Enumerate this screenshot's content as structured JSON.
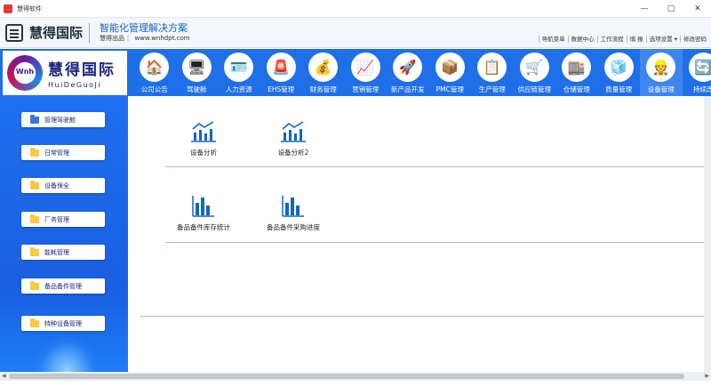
{
  "window": {
    "title": "慧得软件",
    "controls": [
      "—",
      "▢",
      "✕"
    ]
  },
  "header": {
    "brand": "慧得国际",
    "slogan": "智能化管理解决方案",
    "site": "慧得出品 ： www.wnhdpt.com",
    "links": [
      "导航菜单",
      "数据中心",
      "工作流程",
      "填 报",
      "选项设置 ▾",
      "修改密码"
    ]
  },
  "logo": {
    "mark_text": "Wnh",
    "name_cn": "慧得国际",
    "name_en": "HuiDeGuoJi"
  },
  "nav": {
    "modules": [
      {
        "label": "公司公告",
        "icon": "🏠"
      },
      {
        "label": "驾驶舱",
        "icon": "🖥"
      },
      {
        "label": "人力资源",
        "icon": "🪪"
      },
      {
        "label": "EHS管理",
        "icon": "🚨"
      },
      {
        "label": "财务管理",
        "icon": "💰"
      },
      {
        "label": "营销管理",
        "icon": "📈"
      },
      {
        "label": "新产品开发",
        "icon": "🚀"
      },
      {
        "label": "PMC管理",
        "icon": "📦"
      },
      {
        "label": "生产管理",
        "icon": "📋"
      },
      {
        "label": "供应链管理",
        "icon": "🛒"
      },
      {
        "label": "仓储管理",
        "icon": "🏬"
      },
      {
        "label": "质量管理",
        "icon": "🧊"
      },
      {
        "label": "设备管理",
        "icon": "👷"
      },
      {
        "label": "持续改",
        "icon": "🔄"
      }
    ],
    "active": "设备管理"
  },
  "sidebar": {
    "items": [
      {
        "label": "管理驾驶舱"
      },
      {
        "label": "日常管理"
      },
      {
        "label": "设备保全"
      },
      {
        "label": "厂务管理"
      },
      {
        "label": "能耗管理"
      },
      {
        "label": "备品备件管理"
      },
      {
        "label": "特种设备管理"
      }
    ]
  },
  "main": {
    "items": [
      {
        "label": "设备分析",
        "icon": "line-chart-icon"
      },
      {
        "label": "设备分析2",
        "icon": "line-chart-icon"
      },
      {
        "label": "备品备件库存统计",
        "icon": "bar-chart-icon"
      },
      {
        "label": "备品备件采购进度",
        "icon": "bar-chart-icon"
      }
    ]
  },
  "colors": {
    "nav_blue": "#1e6fe8",
    "accent_blue": "#1565c0",
    "folder_yellow": "#f7c948"
  }
}
